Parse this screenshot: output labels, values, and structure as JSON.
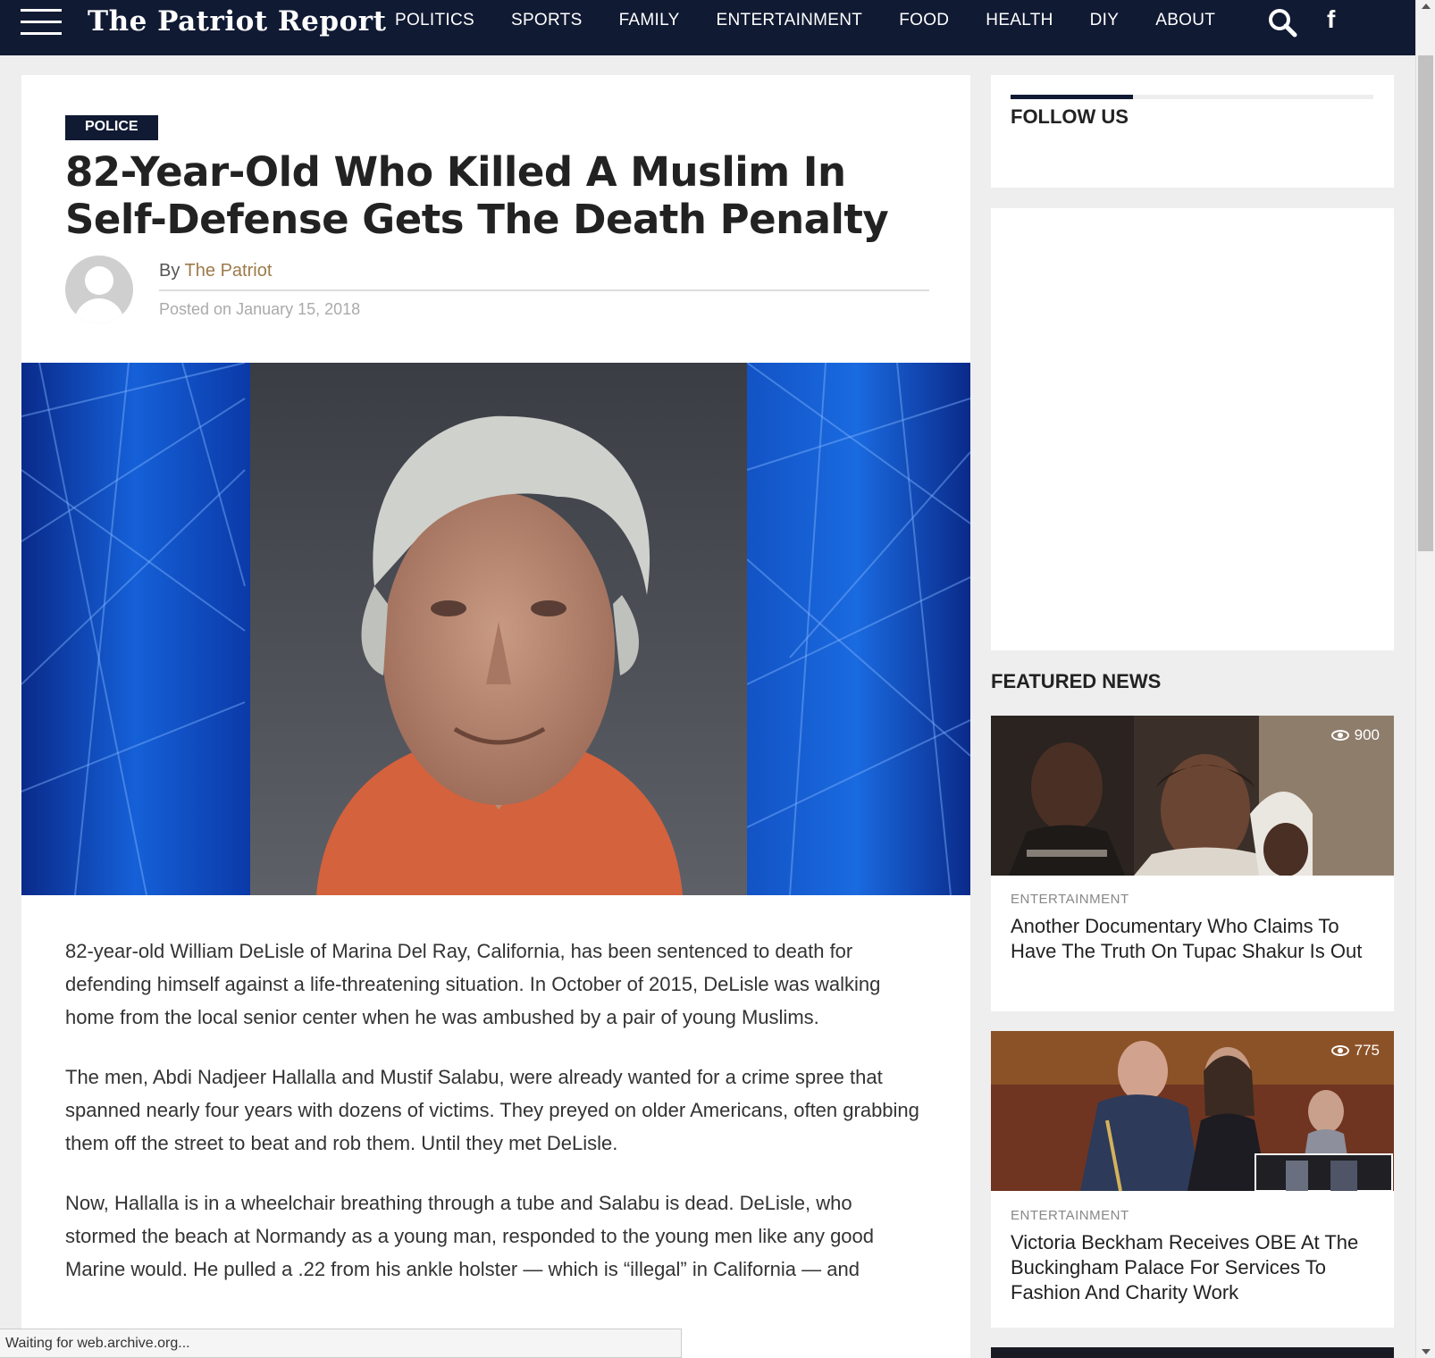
{
  "nav": {
    "logo": "The Patriot Report",
    "links": [
      "POLITICS",
      "SPORTS",
      "FAMILY",
      "ENTERTAINMENT",
      "FOOD",
      "HEALTH",
      "DIY",
      "ABOUT"
    ],
    "facebook_glyph": "f"
  },
  "article": {
    "category": "POLICE",
    "headline": "82-Year-Old Who Killed A Muslim In Self-Defense Gets The Death Penalty",
    "by_prefix": "By",
    "author": "The Patriot",
    "posted": "Posted on January 15, 2018",
    "paragraphs": [
      "82-year-old William DeLisle of Marina Del Ray, California, has been sentenced to death for defending himself against a life-threatening situation. In October of 2015, DeLisle was walking home from the local senior center when he was ambushed by a pair of young Muslims.",
      "The men, Abdi Nadjeer Hallalla and Mustif Salabu, were already wanted for a crime spree that spanned nearly four years with dozens of victims. They preyed on older Americans, often grabbing them off the street to beat and rob them. Until they met DeLisle.",
      "Now, Hallalla is in a wheelchair breathing through a tube and Salabu is dead. DeLisle, who stormed the beach at Normandy as a young man, responded to the young men like any good Marine would. He pulled a .22 from his ankle holster — which is “illegal” in California — and"
    ]
  },
  "sidebar": {
    "follow_title": "FOLLOW US",
    "featured_title": "FEATURED NEWS",
    "featured": [
      {
        "views": "900",
        "category": "ENTERTAINMENT",
        "headline": "Another Documentary Who Claims To Have The Truth On Tupac Shakur Is Out"
      },
      {
        "views": "775",
        "category": "ENTERTAINMENT",
        "headline": "Victoria Beckham Receives OBE At The Buckingham Palace For Services To Fashion And Charity Work"
      }
    ]
  },
  "status": "Waiting for web.archive.org..."
}
